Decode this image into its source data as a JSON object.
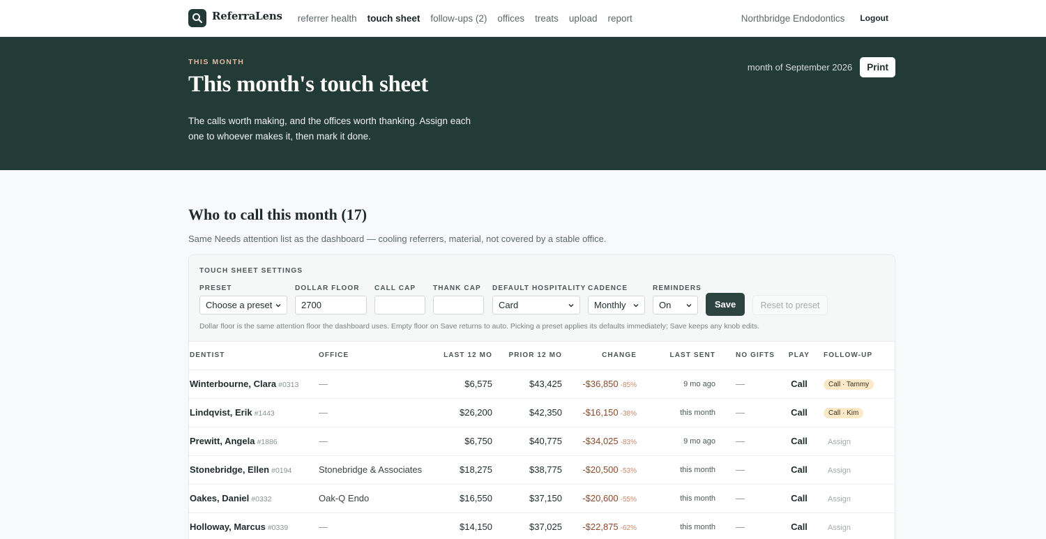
{
  "nav": {
    "brand": "ReferraLens",
    "links": [
      "referrer health",
      "touch sheet",
      "follow-ups (2)",
      "offices",
      "treats",
      "upload",
      "report"
    ],
    "active_index": 1,
    "practice": "Northbridge Endodontics",
    "logout": "Logout"
  },
  "hero": {
    "eyebrow": "THIS MONTH",
    "title": "This month's touch sheet",
    "description": "The calls worth making, and the offices worth thanking. Assign each one to whoever makes it, then mark it done.",
    "period": "month of September 2026",
    "print": "Print"
  },
  "section": {
    "title": "Who to call this month (17)",
    "subtitle": "Same Needs attention list as the dashboard — cooling referrers, material, not covered by a stable office."
  },
  "settings": {
    "title": "TOUCH SHEET SETTINGS",
    "preset": {
      "label": "PRESET",
      "value": "Choose a preset"
    },
    "dollar_floor": {
      "label": "DOLLAR FLOOR",
      "value": "2700"
    },
    "call_cap": {
      "label": "CALL CAP",
      "value": ""
    },
    "thank_cap": {
      "label": "THANK CAP",
      "value": ""
    },
    "hospitality": {
      "label": "DEFAULT HOSPITALITY",
      "value": "Card"
    },
    "cadence": {
      "label": "CADENCE",
      "value": "Monthly"
    },
    "reminders": {
      "label": "REMINDERS",
      "value": "On"
    },
    "save": "Save",
    "reset": "Reset to preset",
    "help": "Dollar floor is the same attention floor the dashboard uses. Empty floor on Save returns to auto. Picking a preset applies its defaults immediately; Save keeps any knob edits."
  },
  "table": {
    "headers": [
      "DENTIST",
      "OFFICE",
      "LAST 12 MO",
      "PRIOR 12 MO",
      "CHANGE",
      "LAST SENT",
      "NO GIFTS",
      "PLAY",
      "FOLLOW-UP"
    ],
    "rows": [
      {
        "name": "Winterbourne, Clara",
        "id": "#0313",
        "office": "—",
        "last12": "$6,575",
        "prior12": "$43,425",
        "change": "-$36,850",
        "pct": "-85%",
        "last_sent": "9 mo ago",
        "no_gifts": "—",
        "play": "Call",
        "followup": "Call · Tammy",
        "assigned": true
      },
      {
        "name": "Lindqvist, Erik",
        "id": "#1443",
        "office": "—",
        "last12": "$26,200",
        "prior12": "$42,350",
        "change": "-$16,150",
        "pct": "-38%",
        "last_sent": "this month",
        "no_gifts": "—",
        "play": "Call",
        "followup": "Call · Kim",
        "assigned": true
      },
      {
        "name": "Prewitt, Angela",
        "id": "#1886",
        "office": "—",
        "last12": "$6,750",
        "prior12": "$40,775",
        "change": "-$34,025",
        "pct": "-83%",
        "last_sent": "9 mo ago",
        "no_gifts": "—",
        "play": "Call",
        "followup": "Assign",
        "assigned": false
      },
      {
        "name": "Stonebridge, Ellen",
        "id": "#0194",
        "office": "Stonebridge & Associates",
        "last12": "$18,275",
        "prior12": "$38,775",
        "change": "-$20,500",
        "pct": "-53%",
        "last_sent": "this month",
        "no_gifts": "—",
        "play": "Call",
        "followup": "Assign",
        "assigned": false
      },
      {
        "name": "Oakes, Daniel",
        "id": "#0332",
        "office": "Oak-Q Endo",
        "last12": "$16,550",
        "prior12": "$37,150",
        "change": "-$20,600",
        "pct": "-55%",
        "last_sent": "this month",
        "no_gifts": "—",
        "play": "Call",
        "followup": "Assign",
        "assigned": false
      },
      {
        "name": "Holloway, Marcus",
        "id": "#0339",
        "office": "—",
        "last12": "$14,150",
        "prior12": "$37,025",
        "change": "-$22,875",
        "pct": "-62%",
        "last_sent": "this month",
        "no_gifts": "—",
        "play": "Call",
        "followup": "Assign",
        "assigned": false
      }
    ]
  },
  "colors": {
    "hero_bg": "#233b37",
    "accent_warm": "#e6b8a2",
    "chip_bg": "#fbe9c7",
    "change": "#8a4a2b"
  }
}
